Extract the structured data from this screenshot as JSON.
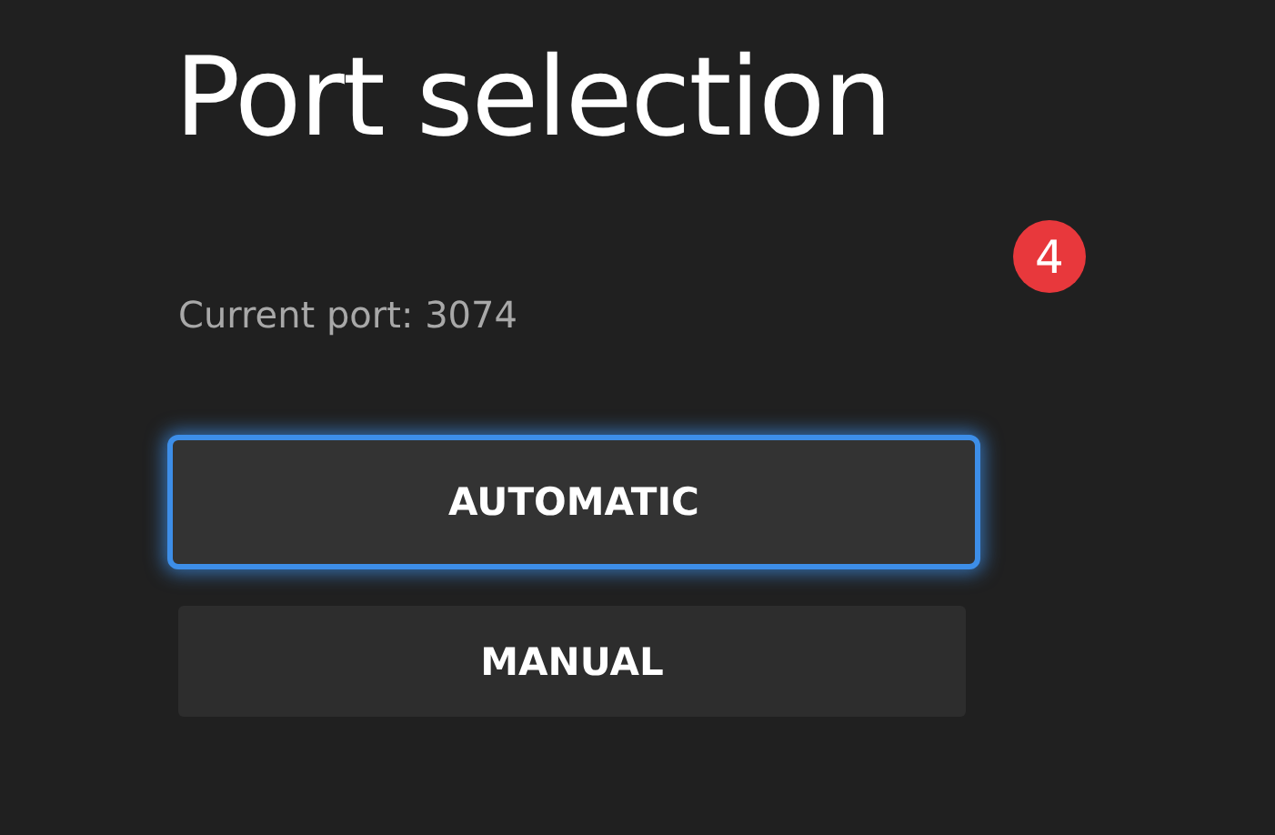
{
  "title": "Port selection",
  "current_port": "Current port: 3074",
  "badge": "4",
  "buttons": [
    {
      "label": "AUTOMATIC",
      "selected": true
    },
    {
      "label": "MANUAL",
      "selected": false
    }
  ]
}
